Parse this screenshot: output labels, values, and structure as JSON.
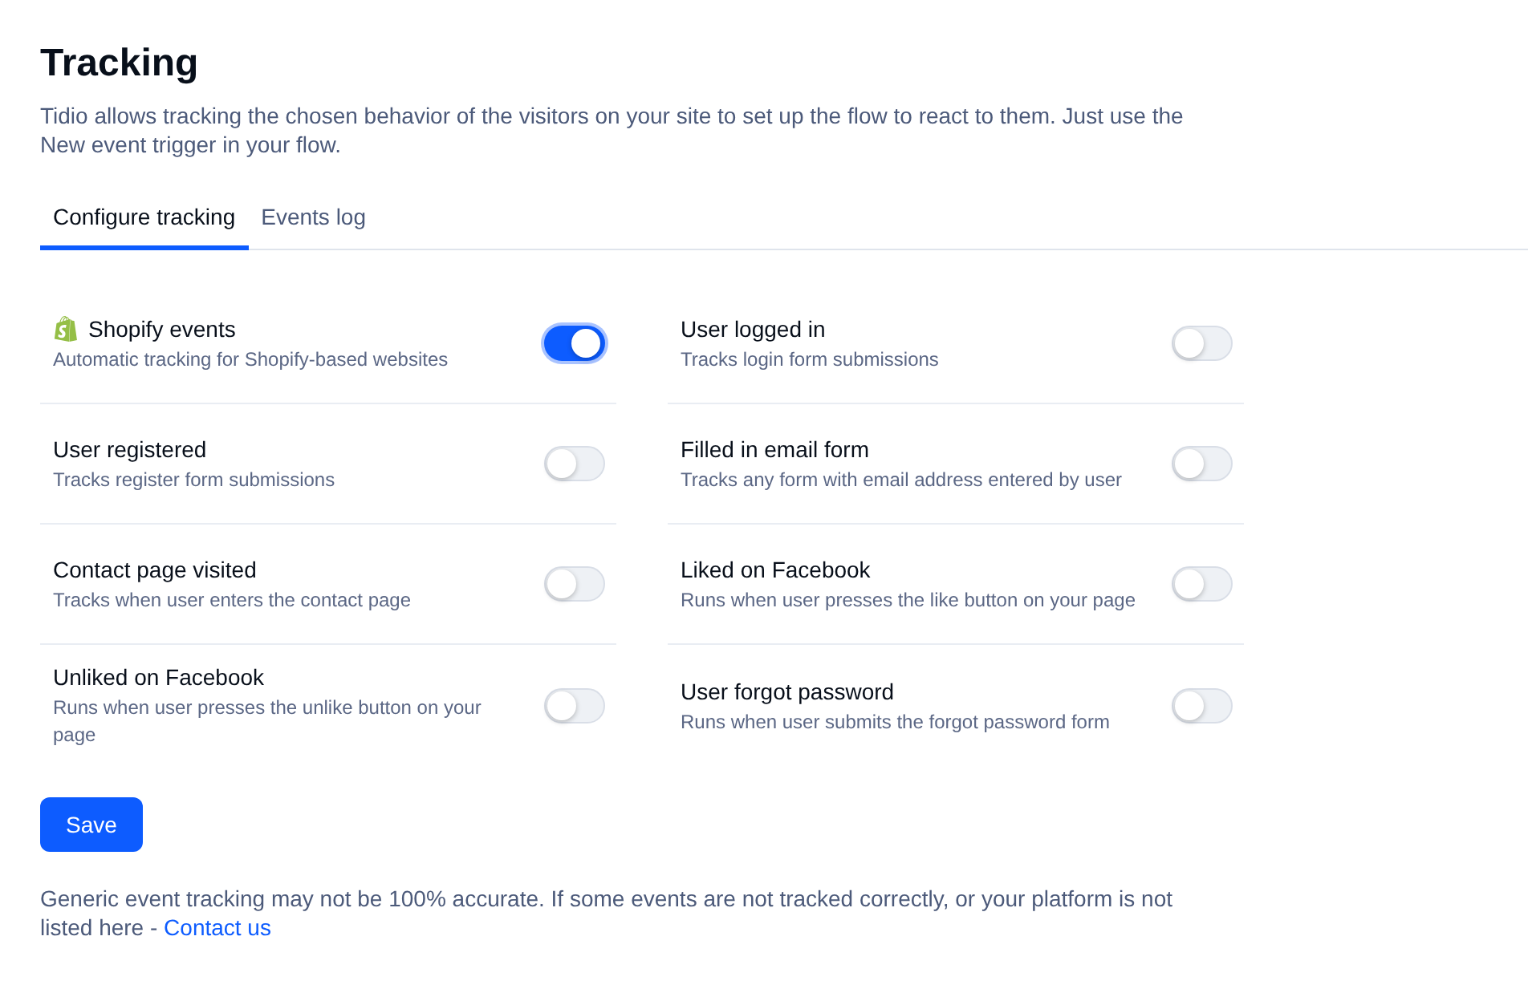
{
  "title": "Tracking",
  "description": "Tidio allows tracking the chosen behavior of the visitors on your site to set up the flow to react to them. Just use the New event trigger in your flow.",
  "tabs": [
    {
      "label": "Configure tracking",
      "selected": true
    },
    {
      "label": "Events log",
      "selected": false
    }
  ],
  "events": [
    {
      "kind": "platform",
      "title": "Shopify events",
      "description": "Automatic tracking for Shopify-based websites",
      "on": true
    },
    {
      "kind": "event",
      "title": "User logged in",
      "description": "Tracks login form submissions",
      "on": false
    },
    {
      "kind": "event",
      "title": "User registered",
      "description": "Tracks register form submissions",
      "on": false
    },
    {
      "kind": "event",
      "title": "Filled in email form",
      "description": "Tracks any form with email address entered by user",
      "on": false
    },
    {
      "kind": "event",
      "title": "Contact page visited",
      "description": "Tracks when user enters the contact page",
      "on": false
    },
    {
      "kind": "event",
      "title": "Liked on Facebook",
      "description": "Runs when user presses the like button on your page",
      "on": false
    },
    {
      "kind": "event",
      "title": "Unliked on Facebook",
      "description": "Runs when user presses the unlike button on your page",
      "on": false
    },
    {
      "kind": "event",
      "title": "User forgot password",
      "description": "Runs when user submits the forgot password form",
      "on": false
    }
  ],
  "save_button": "Save",
  "footer": {
    "text": "Generic event tracking may not be 100% accurate. If some events are not tracked correctly, or your platform is not listed here -",
    "link": "Contact us"
  }
}
